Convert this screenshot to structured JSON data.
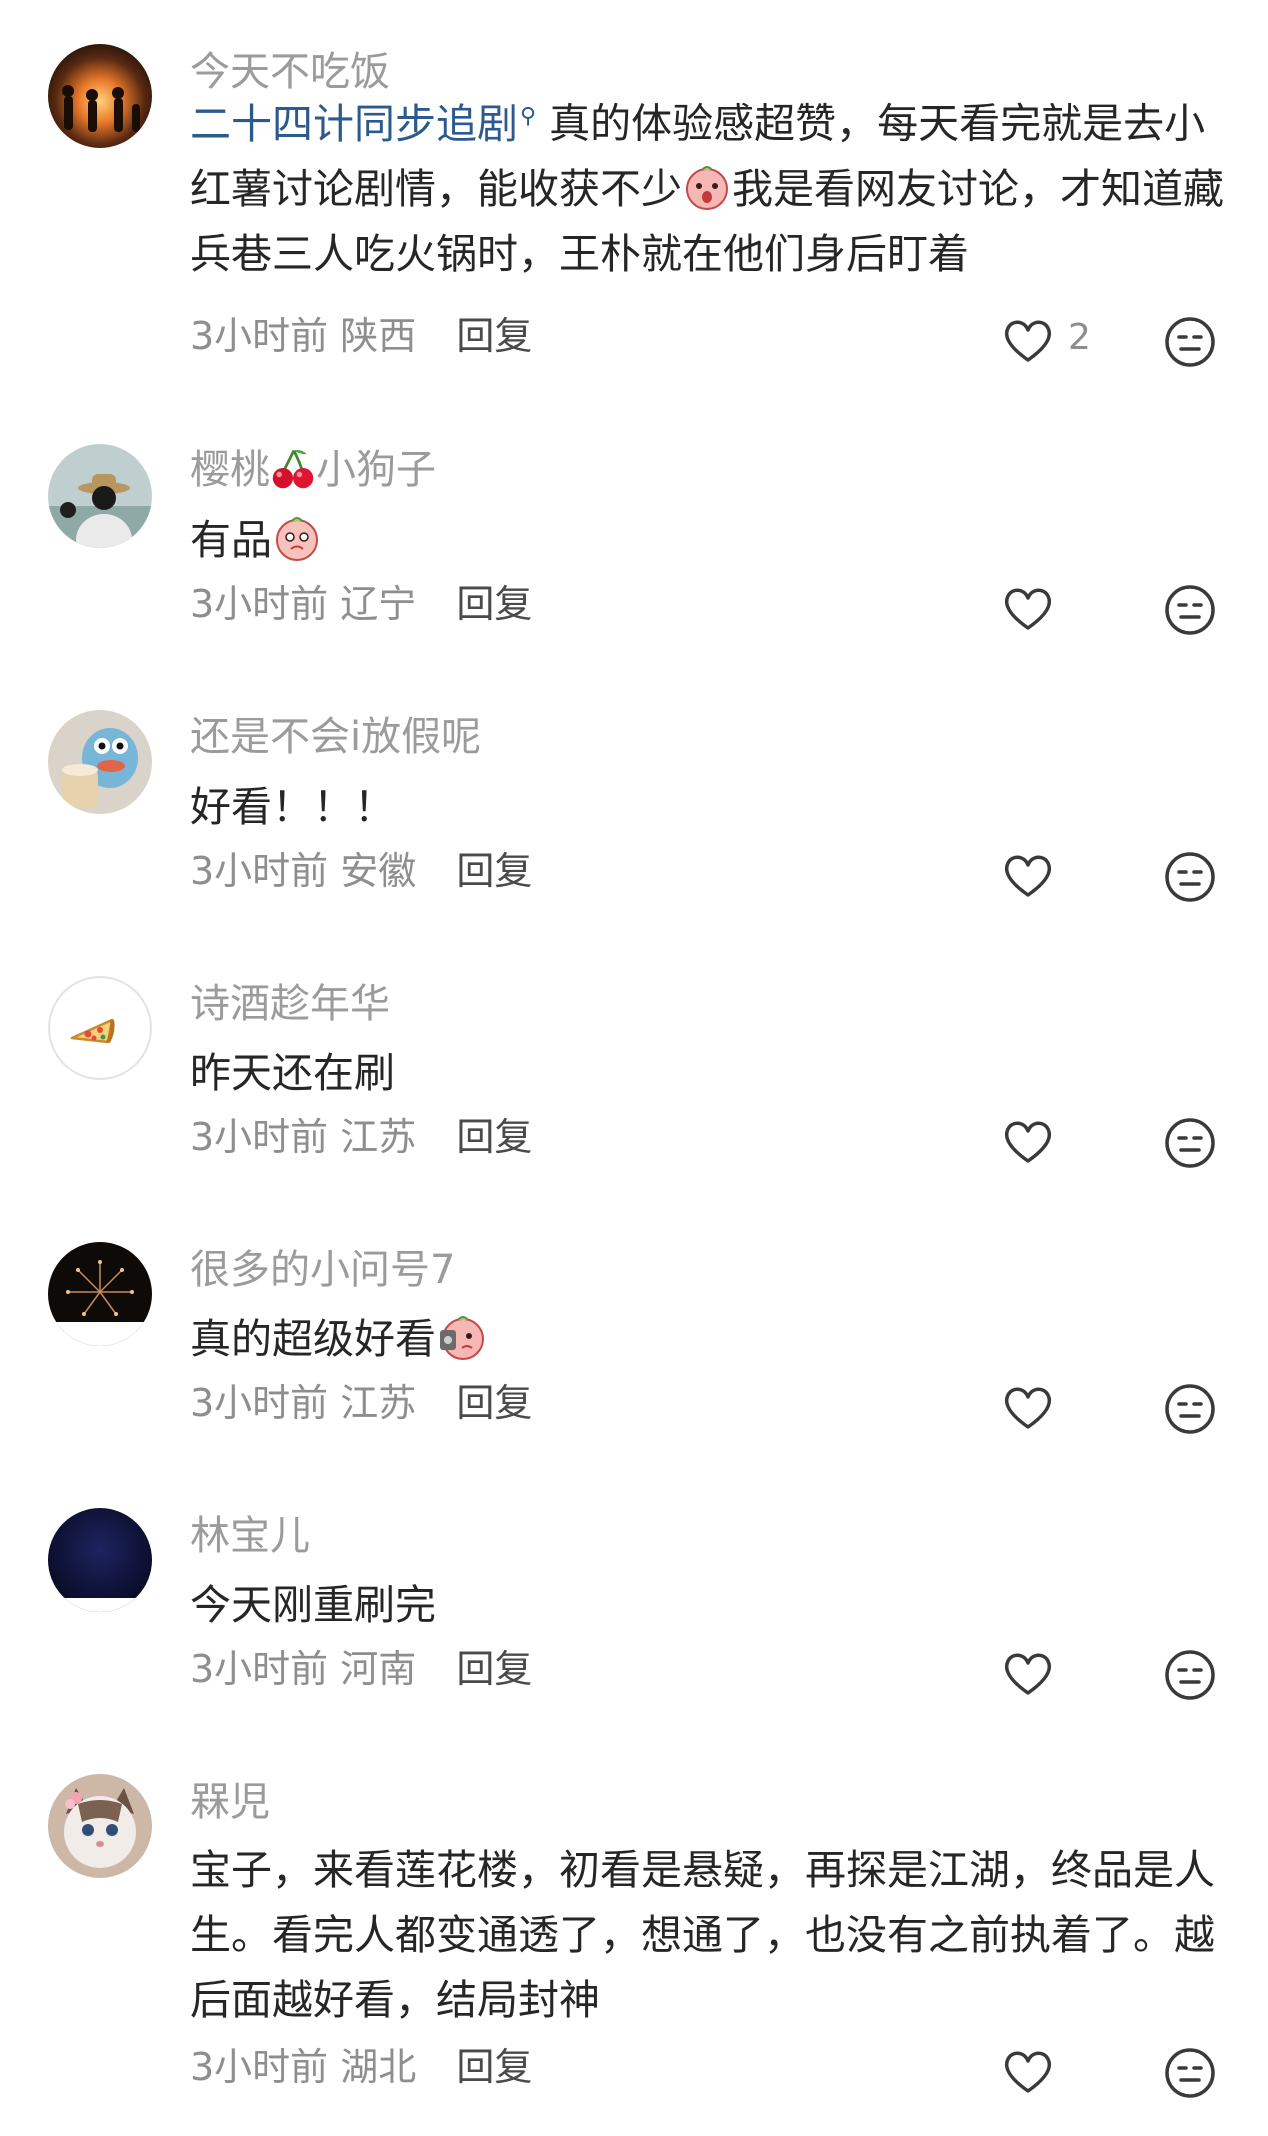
{
  "comments": [
    {
      "username": "今天不吃饭",
      "hashtag": "二十四计同步追剧",
      "text_parts": [
        "真的体验感超赞，每天看完就是去小红薯讨论剧情，能收获不少",
        "我是看网友讨论，才知道藏兵巷三人吃火锅时，王朴就在他们身后盯着"
      ],
      "time": "3小时前",
      "location": "陕西",
      "reply_label": "回复",
      "like_count": "2"
    },
    {
      "username_part1": "樱桃",
      "username_part2": "小狗子",
      "text": "有品",
      "time": "3小时前",
      "location": "辽宁",
      "reply_label": "回复"
    },
    {
      "username": "还是不会i放假呢",
      "text": "好看！！！",
      "time": "3小时前",
      "location": "安徽",
      "reply_label": "回复"
    },
    {
      "username": "诗酒趁年华",
      "text": "昨天还在刷",
      "time": "3小时前",
      "location": "江苏",
      "reply_label": "回复"
    },
    {
      "username": "很多的小问号7",
      "text": "真的超级好看",
      "time": "3小时前",
      "location": "江苏",
      "reply_label": "回复"
    },
    {
      "username": "林宝儿",
      "text": "今天刚重刷完",
      "time": "3小时前",
      "location": "河南",
      "reply_label": "回复"
    },
    {
      "username": "槑児",
      "text": "宝子，来看莲花楼，初看是悬疑，再探是江湖，终品是人生。看完人都变通透了，想通了，也没有之前执着了。越后面越好看，结局封神",
      "time": "3小时前",
      "location": "湖北",
      "reply_label": "回复"
    }
  ],
  "icons": {
    "like": "heart-outline-icon",
    "react": "neutral-face-icon",
    "hashtag_marker": "magnifier-icon",
    "emoji_sticker": "pink-peach-emoji"
  },
  "colors": {
    "hashtag": "#2c5a8f",
    "username": "#9b9b9b",
    "body": "#262626",
    "meta": "#8e8e8e",
    "icon_stroke": "#3a3a3a"
  }
}
